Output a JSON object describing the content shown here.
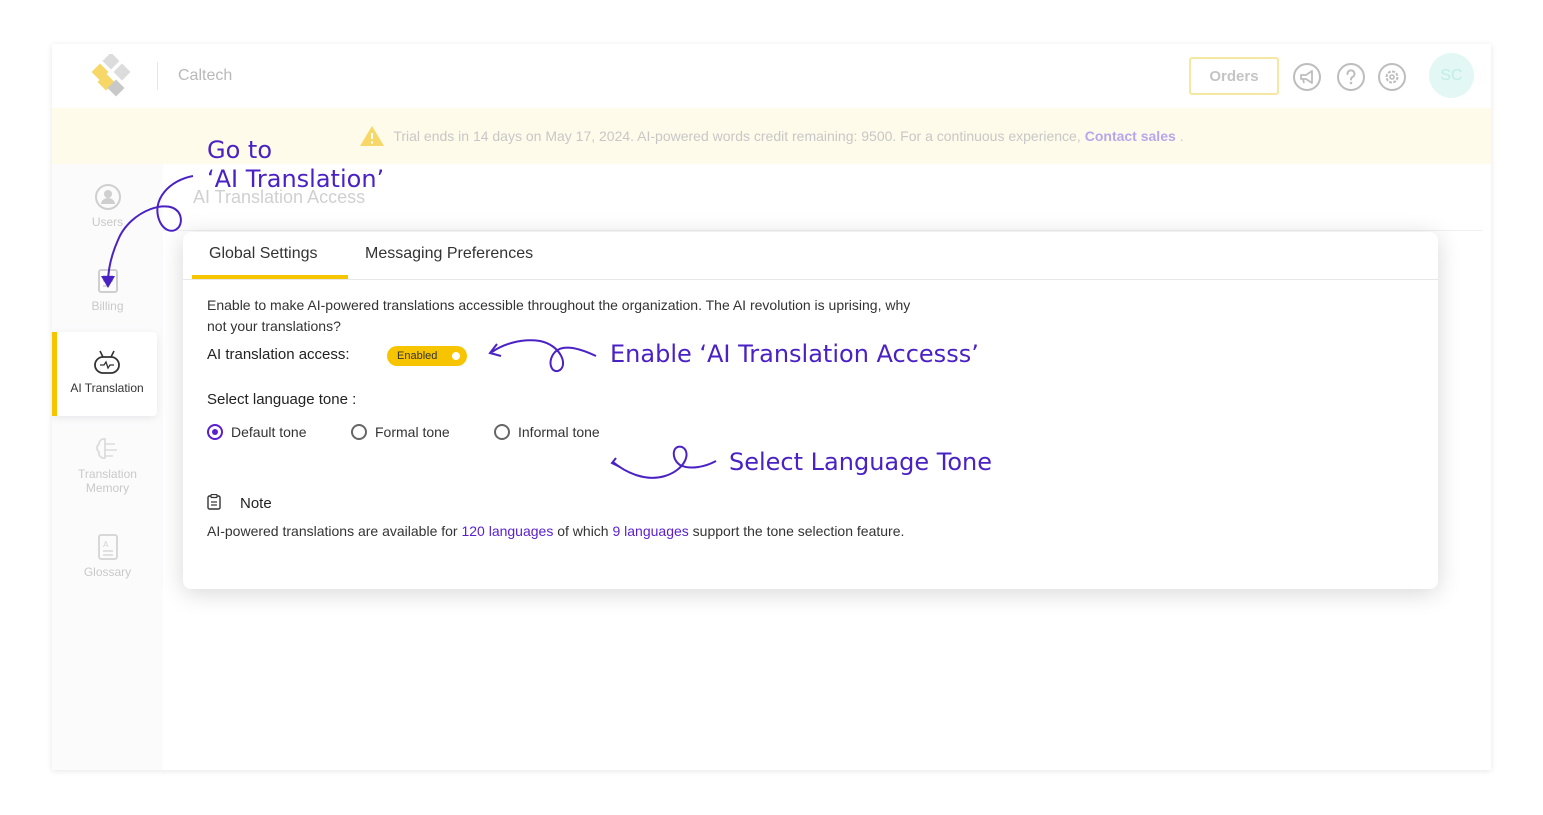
{
  "header": {
    "org_name": "Caltech",
    "orders_label": "Orders",
    "avatar_initials": "SC",
    "icons": [
      "megaphone-icon",
      "help-icon",
      "gear-icon"
    ]
  },
  "banner": {
    "message": "Trial ends in 14 days on May 17, 2024. AI-powered words credit remaining: 9500. For a continuous experience,",
    "link_label": "Contact sales",
    "suffix": "."
  },
  "sidebar": {
    "items": [
      {
        "label": "Users",
        "icon": "user-icon"
      },
      {
        "label": "Billing",
        "icon": "billing-icon"
      },
      {
        "label": "AI Translation",
        "icon": "robot-icon",
        "active": true
      },
      {
        "label": "Translation Memory",
        "icon": "brain-icon"
      },
      {
        "label": "Glossary",
        "icon": "glossary-icon"
      }
    ]
  },
  "page": {
    "title": "AI Translation Access"
  },
  "card": {
    "tabs": [
      {
        "label": "Global Settings",
        "active": true
      },
      {
        "label": "Messaging Preferences",
        "active": false
      }
    ],
    "description": "Enable to make AI-powered translations accessible throughout the organization. The AI revolution is uprising, why not your translations?",
    "access_label": "AI translation access:",
    "toggle_label": "Enabled",
    "tone_label": "Select language tone :",
    "tones": [
      {
        "label": "Default tone",
        "selected": true
      },
      {
        "label": "Formal tone",
        "selected": false
      },
      {
        "label": "Informal tone",
        "selected": false
      }
    ],
    "note": {
      "title": "Note",
      "text_1": "AI-powered translations are available for",
      "link_1": "120 languages",
      "text_2": "of which",
      "link_2": "9 languages",
      "text_3": "support the tone selection feature."
    }
  },
  "annotations": {
    "goto_line1": "Go to",
    "goto_line2": "‘AI Translation’",
    "enable": "Enable ‘AI Translation Accesss’",
    "tone": "Select Language Tone"
  },
  "colors": {
    "accent_yellow": "#f7c500",
    "accent_purple": "#5a1dcf",
    "annotation": "#4a22c4",
    "banner_bg": "#fffbea"
  }
}
